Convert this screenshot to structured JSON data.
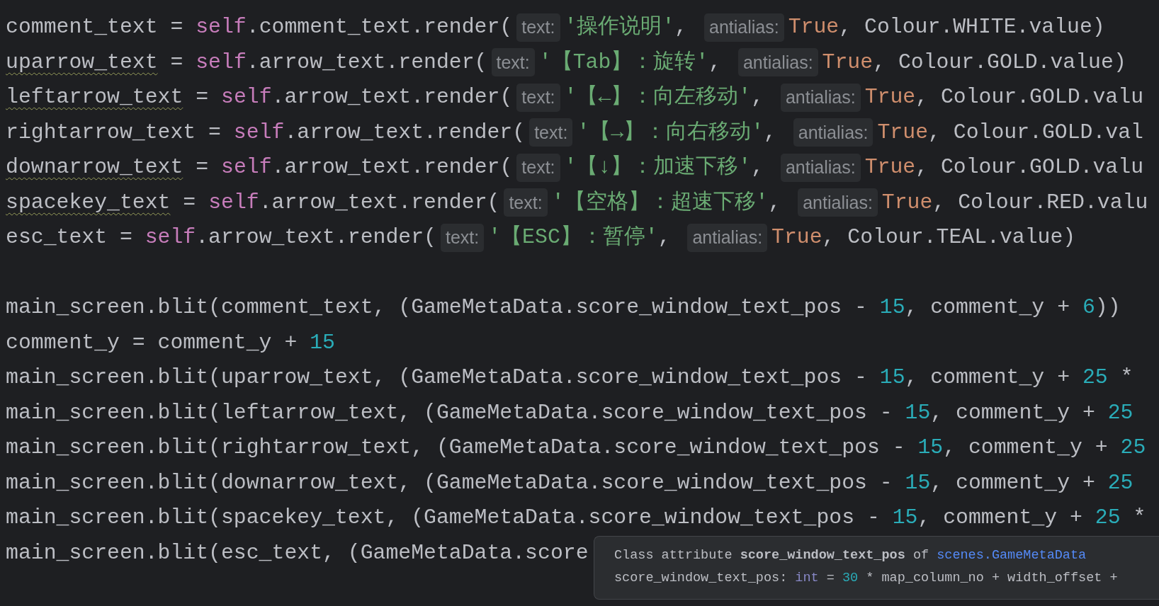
{
  "editor": {
    "lines": [
      {
        "kind": "code",
        "tokens": [
          {
            "kind": "ident",
            "text": "comment_text = "
          },
          {
            "kind": "self",
            "text": "self"
          },
          {
            "kind": "ident",
            "text": ".comment_text.render("
          },
          {
            "kind": "hint",
            "text": "text:"
          },
          {
            "kind": "str",
            "text": "'操作说明'"
          },
          {
            "kind": "ident",
            "text": ", "
          },
          {
            "kind": "hint",
            "text": "antialias:"
          },
          {
            "kind": "kw",
            "text": "True"
          },
          {
            "kind": "ident",
            "text": ", Colour.WHITE.value)"
          }
        ]
      },
      {
        "kind": "code",
        "tokens": [
          {
            "kind": "warn",
            "text": "uparrow_text"
          },
          {
            "kind": "ident",
            "text": " = "
          },
          {
            "kind": "self",
            "text": "self"
          },
          {
            "kind": "ident",
            "text": ".arrow_text.render("
          },
          {
            "kind": "hint",
            "text": "text:"
          },
          {
            "kind": "str",
            "text": "'【Tab】：旋转'"
          },
          {
            "kind": "ident",
            "text": ", "
          },
          {
            "kind": "hint",
            "text": "antialias:"
          },
          {
            "kind": "kw",
            "text": "True"
          },
          {
            "kind": "ident",
            "text": ", Colour.GOLD.value)"
          }
        ]
      },
      {
        "kind": "code",
        "tokens": [
          {
            "kind": "warn",
            "text": "leftarrow_text"
          },
          {
            "kind": "ident",
            "text": " = "
          },
          {
            "kind": "self",
            "text": "self"
          },
          {
            "kind": "ident",
            "text": ".arrow_text.render("
          },
          {
            "kind": "hint",
            "text": "text:"
          },
          {
            "kind": "str",
            "text": "'【←】：向左移动'"
          },
          {
            "kind": "ident",
            "text": ", "
          },
          {
            "kind": "hint",
            "text": "antialias:"
          },
          {
            "kind": "kw",
            "text": "True"
          },
          {
            "kind": "ident",
            "text": ", Colour.GOLD.valu"
          }
        ]
      },
      {
        "kind": "code",
        "tokens": [
          {
            "kind": "ident",
            "text": "rightarrow_text = "
          },
          {
            "kind": "self",
            "text": "self"
          },
          {
            "kind": "ident",
            "text": ".arrow_text.render("
          },
          {
            "kind": "hint",
            "text": "text:"
          },
          {
            "kind": "str",
            "text": "'【→】：向右移动'"
          },
          {
            "kind": "ident",
            "text": ", "
          },
          {
            "kind": "hint",
            "text": "antialias:"
          },
          {
            "kind": "kw",
            "text": "True"
          },
          {
            "kind": "ident",
            "text": ", Colour.GOLD.val"
          }
        ]
      },
      {
        "kind": "code",
        "tokens": [
          {
            "kind": "warn",
            "text": "downarrow_text"
          },
          {
            "kind": "ident",
            "text": " = "
          },
          {
            "kind": "self",
            "text": "self"
          },
          {
            "kind": "ident",
            "text": ".arrow_text.render("
          },
          {
            "kind": "hint",
            "text": "text:"
          },
          {
            "kind": "str",
            "text": "'【↓】：加速下移'"
          },
          {
            "kind": "ident",
            "text": ", "
          },
          {
            "kind": "hint",
            "text": "antialias:"
          },
          {
            "kind": "kw",
            "text": "True"
          },
          {
            "kind": "ident",
            "text": ", Colour.GOLD.valu"
          }
        ]
      },
      {
        "kind": "code",
        "tokens": [
          {
            "kind": "warn",
            "text": "spacekey_text"
          },
          {
            "kind": "ident",
            "text": " = "
          },
          {
            "kind": "self",
            "text": "self"
          },
          {
            "kind": "ident",
            "text": ".arrow_text.render("
          },
          {
            "kind": "hint",
            "text": "text:"
          },
          {
            "kind": "str",
            "text": "'【空格】：超速下移'"
          },
          {
            "kind": "ident",
            "text": ", "
          },
          {
            "kind": "hint",
            "text": "antialias:"
          },
          {
            "kind": "kw",
            "text": "True"
          },
          {
            "kind": "ident",
            "text": ", Colour.RED.valu"
          }
        ]
      },
      {
        "kind": "code",
        "tokens": [
          {
            "kind": "ident",
            "text": "esc_text = "
          },
          {
            "kind": "self",
            "text": "self"
          },
          {
            "kind": "ident",
            "text": ".arrow_text.render("
          },
          {
            "kind": "hint",
            "text": "text:"
          },
          {
            "kind": "str",
            "text": "'【ESC】：暂停'"
          },
          {
            "kind": "ident",
            "text": ", "
          },
          {
            "kind": "hint",
            "text": "antialias:"
          },
          {
            "kind": "kw",
            "text": "True"
          },
          {
            "kind": "ident",
            "text": ", Colour.TEAL.value)"
          }
        ]
      },
      {
        "kind": "blank"
      },
      {
        "kind": "code",
        "tokens": [
          {
            "kind": "ident",
            "text": "main_screen.blit(comment_text, (GameMetaData.score_window_text_pos - "
          },
          {
            "kind": "num",
            "text": "15"
          },
          {
            "kind": "ident",
            "text": ", comment_y + "
          },
          {
            "kind": "num",
            "text": "6"
          },
          {
            "kind": "ident",
            "text": "))"
          }
        ]
      },
      {
        "kind": "code",
        "tokens": [
          {
            "kind": "ident",
            "text": "comment_y = comment_y + "
          },
          {
            "kind": "num",
            "text": "15"
          }
        ]
      },
      {
        "kind": "code",
        "tokens": [
          {
            "kind": "ident",
            "text": "main_screen.blit(uparrow_text, (GameMetaData.score_window_text_pos - "
          },
          {
            "kind": "num",
            "text": "15"
          },
          {
            "kind": "ident",
            "text": ", comment_y + "
          },
          {
            "kind": "num",
            "text": "25"
          },
          {
            "kind": "ident",
            "text": " *"
          }
        ]
      },
      {
        "kind": "code",
        "tokens": [
          {
            "kind": "ident",
            "text": "main_screen.blit(leftarrow_text, (GameMetaData.score_window_text_pos - "
          },
          {
            "kind": "num",
            "text": "15"
          },
          {
            "kind": "ident",
            "text": ", comment_y + "
          },
          {
            "kind": "num",
            "text": "25"
          }
        ]
      },
      {
        "kind": "code",
        "tokens": [
          {
            "kind": "ident",
            "text": "main_screen.blit(rightarrow_text, (GameMetaData.score_window_text_pos - "
          },
          {
            "kind": "num",
            "text": "15"
          },
          {
            "kind": "ident",
            "text": ", comment_y + "
          },
          {
            "kind": "num",
            "text": "25"
          }
        ]
      },
      {
        "kind": "code",
        "tokens": [
          {
            "kind": "ident",
            "text": "main_screen.blit(downarrow_text, (GameMetaData.score_window_text_pos - "
          },
          {
            "kind": "num",
            "text": "15"
          },
          {
            "kind": "ident",
            "text": ", comment_y + "
          },
          {
            "kind": "num",
            "text": "25"
          }
        ]
      },
      {
        "kind": "code",
        "tokens": [
          {
            "kind": "ident",
            "text": "main_screen.blit(spacekey_text, (GameMetaData.score_window_text_pos - "
          },
          {
            "kind": "num",
            "text": "15"
          },
          {
            "kind": "ident",
            "text": ", comment_y + "
          },
          {
            "kind": "num",
            "text": "25"
          },
          {
            "kind": "ident",
            "text": " *"
          }
        ]
      },
      {
        "kind": "code",
        "tokens": [
          {
            "kind": "ident",
            "text": "main_screen.blit(esc_text, (GameMetaData.score"
          }
        ]
      }
    ]
  },
  "tooltip": {
    "heading": "Class attribute **score_window_text_pos** of",
    "link": "scenes.GameMetaData",
    "signature": [
      {
        "kind": "ident",
        "text": "score_window_text_pos: "
      },
      {
        "kind": "type",
        "text": "int"
      },
      {
        "kind": "ident",
        "text": " = "
      },
      {
        "kind": "num",
        "text": "30"
      },
      {
        "kind": "ident",
        "text": " * map_column_no + width_offset +"
      }
    ]
  }
}
